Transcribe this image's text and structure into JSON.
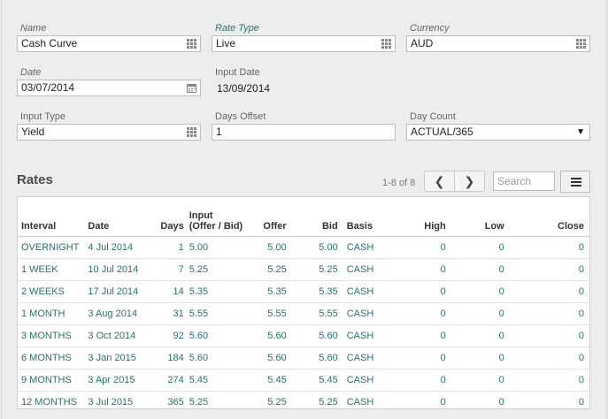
{
  "form": {
    "name": {
      "label": "Name",
      "value": "Cash Curve"
    },
    "rate_type": {
      "label": "Rate Type",
      "value": "Live"
    },
    "currency": {
      "label": "Currency",
      "value": "AUD"
    },
    "date": {
      "label": "Date",
      "value": "03/07/2014"
    },
    "input_date": {
      "label": "Input Date",
      "value": "13/09/2014"
    },
    "input_type": {
      "label": "Input Type",
      "value": "Yield"
    },
    "days_offset": {
      "label": "Days Offset",
      "value": "1"
    },
    "day_count": {
      "label": "Day Count",
      "value": "ACTUAL/365",
      "caret": "▼"
    }
  },
  "rates": {
    "title": "Rates",
    "pager_text": "1-8 of 8",
    "prev": "❮",
    "next": "❯",
    "search_placeholder": "Search",
    "columns": {
      "interval": "Interval",
      "date": "Date",
      "days": "Days",
      "input_line1": "Input",
      "input_line2": "(Offer / Bid)",
      "offer": "Offer",
      "bid": "Bid",
      "basis": "Basis",
      "high": "High",
      "low": "Low",
      "close": "Close"
    },
    "rows": [
      {
        "interval": "OVERNIGHT",
        "date": "4 Jul 2014",
        "days": "1",
        "input": "5.00",
        "offer": "5.00",
        "bid": "5.00",
        "basis": "CASH",
        "high": "0",
        "low": "0",
        "close": "0"
      },
      {
        "interval": "1 WEEK",
        "date": "10 Jul 2014",
        "days": "7",
        "input": "5.25",
        "offer": "5.25",
        "bid": "5.25",
        "basis": "CASH",
        "high": "0",
        "low": "0",
        "close": "0"
      },
      {
        "interval": "2 WEEKS",
        "date": "17 Jul 2014",
        "days": "14",
        "input": "5.35",
        "offer": "5.35",
        "bid": "5.35",
        "basis": "CASH",
        "high": "0",
        "low": "0",
        "close": "0"
      },
      {
        "interval": "1 MONTH",
        "date": "3 Aug 2014",
        "days": "31",
        "input": "5.55",
        "offer": "5.55",
        "bid": "5.55",
        "basis": "CASH",
        "high": "0",
        "low": "0",
        "close": "0"
      },
      {
        "interval": "3 MONTHS",
        "date": "3 Oct 2014",
        "days": "92",
        "input": "5.60",
        "offer": "5.60",
        "bid": "5.60",
        "basis": "CASH",
        "high": "0",
        "low": "0",
        "close": "0"
      },
      {
        "interval": "6 MONTHS",
        "date": "3 Jan 2015",
        "days": "184",
        "input": "5.60",
        "offer": "5.60",
        "bid": "5.60",
        "basis": "CASH",
        "high": "0",
        "low": "0",
        "close": "0"
      },
      {
        "interval": "9 MONTHS",
        "date": "3 Apr 2015",
        "days": "274",
        "input": "5.45",
        "offer": "5.45",
        "bid": "5.45",
        "basis": "CASH",
        "high": "0",
        "low": "0",
        "close": "0"
      },
      {
        "interval": "12 MONTHS",
        "date": "3 Jul 2015",
        "days": "365",
        "input": "5.25",
        "offer": "5.25",
        "bid": "5.25",
        "basis": "CASH",
        "high": "0",
        "low": "0",
        "close": "0"
      }
    ]
  },
  "colors": {
    "accent": "#2d6f6b",
    "background": "#eceeed"
  },
  "icons": {
    "lookup": "grid-icon",
    "calendar": "calendar-icon",
    "menu": "hamburger-menu-icon"
  }
}
